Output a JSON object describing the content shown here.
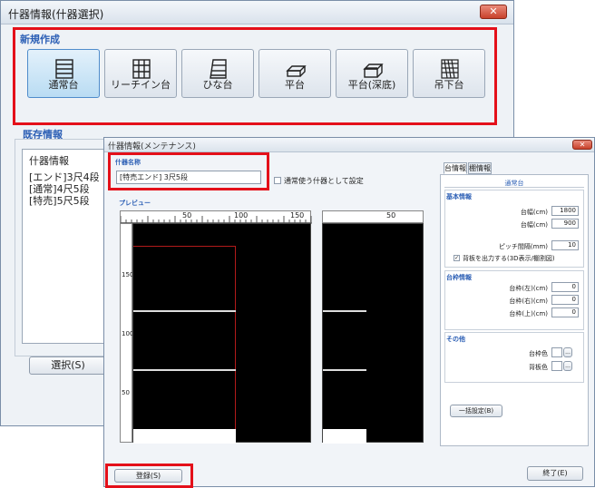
{
  "back_window": {
    "title": "什器情報(什器選択)",
    "close_glyph": "✕",
    "new_group_label": "新規作成",
    "tools": [
      {
        "label": "通常台",
        "icon": "shelf-stack-icon",
        "selected": true
      },
      {
        "label": "リーチイン台",
        "icon": "reach-in-icon",
        "selected": false
      },
      {
        "label": "ひな台",
        "icon": "tiered-stand-icon",
        "selected": false
      },
      {
        "label": "平台",
        "icon": "flat-table-icon",
        "selected": false
      },
      {
        "label": "平台(深底)",
        "icon": "deep-flat-table-icon",
        "selected": false
      },
      {
        "label": "吊下台",
        "icon": "hanging-rack-icon",
        "selected": false
      }
    ],
    "existing_group_label": "既存情報",
    "existing_list_header": "什器情報",
    "existing_items": [
      "[エンド]3尺4段",
      "[通常]4尺5段",
      "[特売]5尺5段"
    ],
    "select_button": "選択(S)"
  },
  "front_window": {
    "title": "什器情報(メンテナンス)",
    "close_glyph": "✕",
    "name_label": "什器名称",
    "name_value": "[特売エンド] 3尺5段",
    "checkbox_label": "通常使う什器として設定",
    "preview_label": "プレビュー",
    "ruler_main": [
      "50",
      "100",
      "150"
    ],
    "ruler_side": [
      "50"
    ],
    "ruler_vertical": [
      "150",
      "100",
      "50"
    ],
    "tabs": [
      "台情報",
      "棚情報"
    ],
    "panel_title": "通常台",
    "basic_section": "基本情報",
    "basic_fields": [
      {
        "label": "台幅(cm)",
        "value": "1800"
      },
      {
        "label": "台幅(cm)",
        "value": "900"
      }
    ],
    "pitch_label": "ピッチ間隔(mm)",
    "pitch_value": "10",
    "backboard_checkbox": "背板を出力する(3D表示/棚割図)",
    "frame_section": "台枠情報",
    "frame_fields": [
      {
        "label": "台枠(左)(cm)",
        "value": "0"
      },
      {
        "label": "台枠(右)(cm)",
        "value": "0"
      },
      {
        "label": "台枠(上)(cm)",
        "value": "0"
      }
    ],
    "other_section": "その他",
    "color_fields": [
      {
        "label": "台枠色",
        "button": "..."
      },
      {
        "label": "背板色",
        "button": "..."
      }
    ],
    "bulk_button": "一括設定(B)",
    "register_button": "登録(S)",
    "exit_button": "終了(E)"
  },
  "colors": {
    "highlight_red": "#e4101a",
    "group_blue": "#2c5fb5",
    "preview_frame_red": "#b31a1a"
  }
}
